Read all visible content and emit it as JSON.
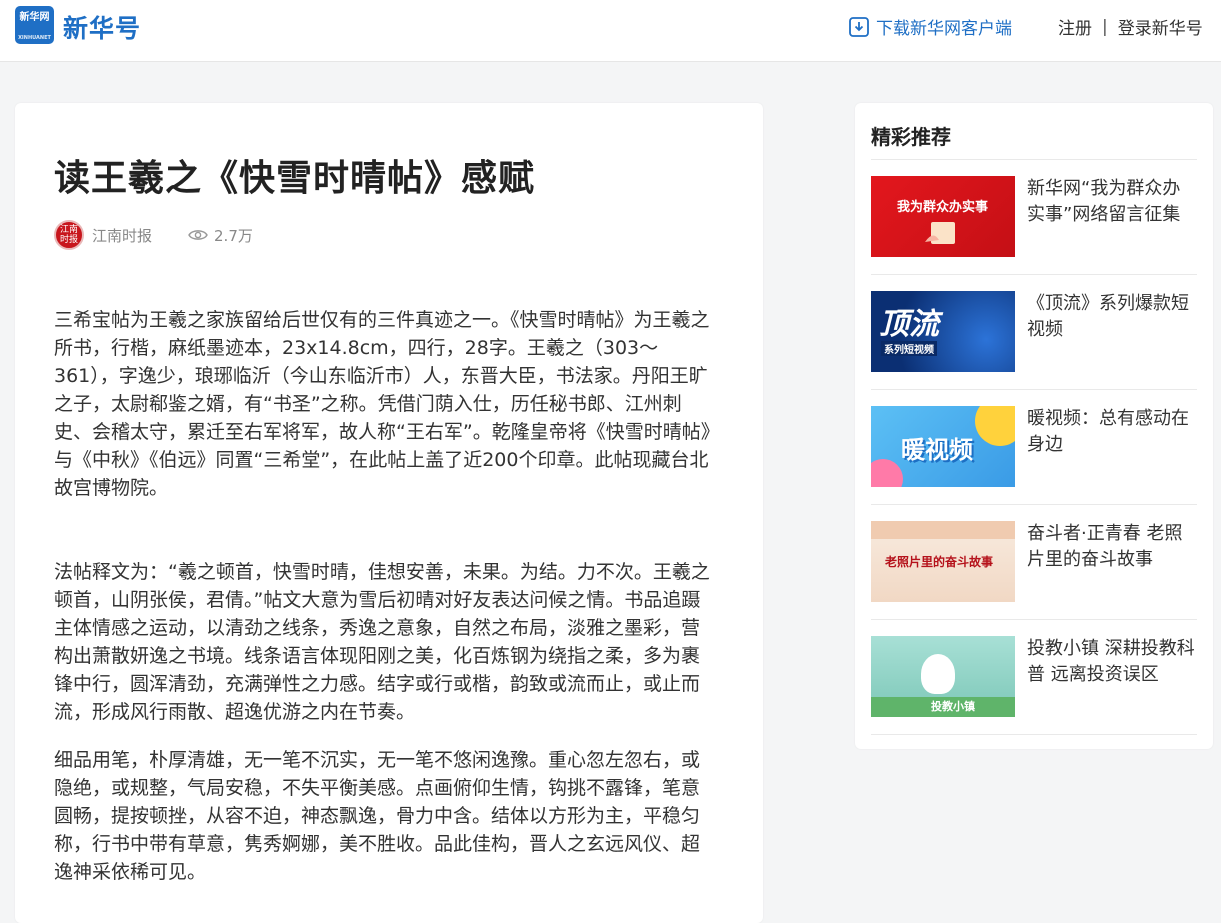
{
  "header": {
    "logo_badge": "新华网",
    "logo_badge_sub": "XINHUANET",
    "logo_text": "新华号",
    "download_label": "下载新华网客户端",
    "register_label": "注册",
    "separator": "|",
    "login_label": "登录新华号"
  },
  "article": {
    "title": "读王羲之《快雪时晴帖》感赋",
    "source": "江南时报",
    "avatar_text": "江南时报",
    "views": "2.7万",
    "paragraphs": [
      "三希宝帖为王羲之家族留给后世仅有的三件真迹之一。《快雪时晴帖》为王羲之所书，行楷，麻纸墨迹本，23x14.8cm，四行，28字。王羲之（303～361），字逸少，琅琊临沂（今山东临沂市）人，东晋大臣，书法家。丹阳王旷之子，太尉郗鉴之婿，有“书圣”之称。凭借门荫入仕，历任秘书郎、江州刺史、会稽太守，累迁至右军将军，故人称“王右军”。乾隆皇帝将《快雪时晴帖》与《中秋》《伯远》同置“三希堂”，在此帖上盖了近200个印章。此帖现藏台北故宫博物院。",
      "法帖释文为：“羲之顿首，快雪时晴，佳想安善，未果。为结。力不次。王羲之顿首，山阴张侯，君倩。”帖文大意为雪后初晴对好友表达问候之情。书品追蹑主体情感之运动，以清劲之线条，秀逸之意象，自然之布局，淡雅之墨彩，营构出萧散妍逸之书境。线条语言体现阳刚之美，化百炼钢为绕指之柔，多为裹锋中行，圆浑清劲，充满弹性之力感。结字或行或楷，韵致或流而止，或止而流，形成风行雨散、超逸优游之内在节奏。",
      "细品用笔，朴厚清雄，无一笔不沉实，无一笔不悠闲逸豫。重心忽左忽右，或隐绝，或规整，气局安稳，不失平衡美感。点画俯仰生情，钩挑不露锋，笔意圆畅，提按顿挫，从容不迫，神态飘逸，骨力中含。结体以方形为主，平稳匀称，行书中带有草意，隽秀婀娜，美不胜收。品此佳构，晋人之玄远风仪、超逸神采依稀可见。"
    ]
  },
  "sidebar": {
    "title": "精彩推荐",
    "items": [
      {
        "text": "新华网“我为群众办实事”网络留言征集",
        "thumb_text": "我为群众办实事",
        "thumb_color": "#d9161c"
      },
      {
        "text": "《顶流》系列爆款短视频",
        "thumb_text": "顶流",
        "thumb_sub": "系列短视频",
        "thumb_color": "#0f3f8c"
      },
      {
        "text": "暖视频：总有感动在身边",
        "thumb_text": "暖视频",
        "thumb_color": "#4fb2f0"
      },
      {
        "text": "奋斗者·正青春 老照片里的奋斗故事",
        "thumb_text": "老照片里的奋斗故事",
        "thumb_color": "#f4e2d2"
      },
      {
        "text": "投教小镇 深耕投教科普 远离投资误区",
        "thumb_text": "投教小镇",
        "thumb_color": "#8fd0c4"
      }
    ]
  },
  "colors": {
    "brand": "#1f6fc5",
    "background": "#f4f5f6"
  }
}
